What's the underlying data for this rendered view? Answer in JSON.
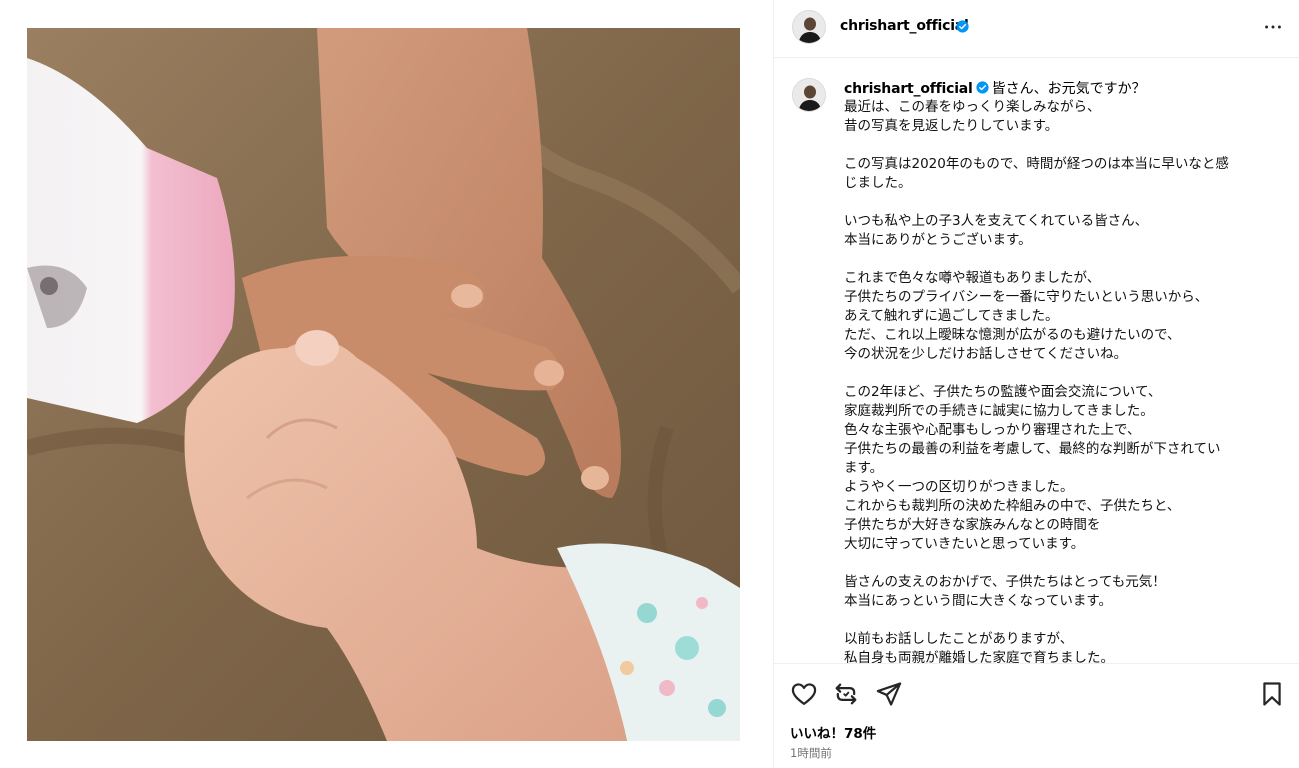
{
  "post": {
    "username": "chrishart_official",
    "caption_username": "chrishart_official",
    "caption_lines": [
      "皆さん、お元気ですか？",
      "最近は、この春をゆっくり楽しみながら、",
      "昔の写真を見返したりしています。",
      "",
      "この写真は2020年のもので、時間が経つのは本当に早いなと感",
      "じました。",
      "",
      "いつも私や上の子3人を支えてくれている皆さん、",
      "本当にありがとうございます。",
      "",
      "これまで色々な噂や報道もありましたが、",
      "子供たちのプライバシーを一番に守りたいという思いから、",
      "あえて触れずに過ごしてきました。",
      "ただ、これ以上曖昧な憶測が広がるのも避けたいので、",
      "今の状況を少しだけお話しさせてくださいね。",
      "",
      "この2年ほど、子供たちの監護や面会交流について、",
      "家庭裁判所での手続きに誠実に協力してきました。",
      "色々な主張や心配事もしっかり審理された上で、",
      "子供たちの最善の利益を考慮して、最終的な判断が下されてい",
      "ます。",
      "ようやく一つの区切りがつきました。",
      "これからも裁判所の決めた枠組みの中で、子供たちと、",
      "子供たちが大好きな家族みんなとの時間を",
      "大切に守っていきたいと思っています。",
      "",
      "皆さんの支えのおかげで、子供たちはとっても元気！",
      "本当にあっという間に大きくなっています。",
      "",
      "以前もお話ししたことがありますが、",
      "私自身も両親が離婚した家庭で育ちました。"
    ],
    "likes": "いいね！78件",
    "timestamp": "1時間前"
  },
  "icons": {
    "verified": "verified-badge-icon",
    "more": "more-options-icon",
    "like": "heart-icon",
    "repost": "repost-icon",
    "share": "share-icon",
    "save": "bookmark-icon"
  },
  "colors": {
    "verified": "#0095f6",
    "secondary_text": "#737373",
    "divider": "#efefef"
  }
}
